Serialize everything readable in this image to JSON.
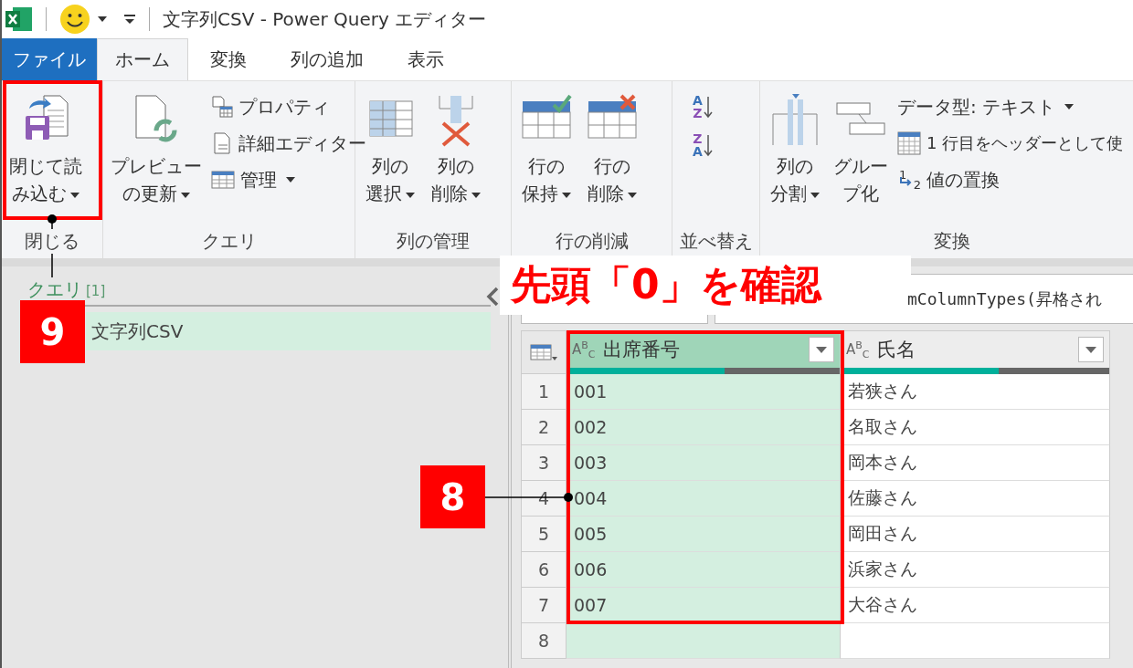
{
  "window": {
    "title": "文字列CSV - Power Query エディター"
  },
  "tabs": [
    {
      "label": "ファイル",
      "kind": "file",
      "selected": false
    },
    {
      "label": "ホーム",
      "kind": "tab",
      "selected": true
    },
    {
      "label": "変換",
      "kind": "tab",
      "selected": false
    },
    {
      "label": "列の追加",
      "kind": "tab",
      "selected": false
    },
    {
      "label": "表示",
      "kind": "tab",
      "selected": false
    }
  ],
  "ribbon": {
    "groups": [
      {
        "label": "閉じる",
        "items": [
          {
            "kind": "large",
            "lines": [
              "閉じて読",
              "み込む"
            ],
            "dropdown": true
          }
        ]
      },
      {
        "label": "クエリ",
        "items": [
          {
            "kind": "large",
            "lines": [
              "プレビュー",
              "の更新"
            ],
            "dropdown": true
          },
          {
            "kind": "stack",
            "items": [
              {
                "label": "プロパティ",
                "dropdown": false
              },
              {
                "label": "詳細エディター",
                "dropdown": false
              },
              {
                "label": "管理",
                "dropdown": true
              }
            ]
          }
        ]
      },
      {
        "label": "列の管理",
        "items": [
          {
            "kind": "large",
            "lines": [
              "列の",
              "選択"
            ],
            "dropdown": true
          },
          {
            "kind": "large",
            "lines": [
              "列の",
              "削除"
            ],
            "dropdown": true
          }
        ]
      },
      {
        "label": "行の削減",
        "items": [
          {
            "kind": "large",
            "lines": [
              "行の",
              "保持"
            ],
            "dropdown": true
          },
          {
            "kind": "large",
            "lines": [
              "行の",
              "削除"
            ],
            "dropdown": true
          }
        ]
      },
      {
        "label": "並べ替え",
        "items": [
          {
            "kind": "sort",
            "orders": [
              {
                "top": "A",
                "bottom": "Z"
              },
              {
                "top": "Z",
                "bottom": "A"
              }
            ]
          }
        ]
      },
      {
        "label": "変換",
        "items": [
          {
            "kind": "large",
            "lines": [
              "列の",
              "分割"
            ],
            "dropdown": true
          },
          {
            "kind": "large",
            "lines": [
              "グルー",
              "プ化"
            ],
            "dropdown": false
          },
          {
            "kind": "stack",
            "items": [
              {
                "label": "データ型: テキスト",
                "dropdown": true
              },
              {
                "label": "1 行目をヘッダーとして使",
                "dropdown": false
              },
              {
                "label": "値の置換",
                "dropdown": false,
                "glyphs": [
                  "1",
                  "2"
                ]
              }
            ]
          }
        ]
      }
    ]
  },
  "queries": {
    "title": "クエリ",
    "count": "[1]",
    "items": [
      {
        "label": "文字列CSV",
        "selected": true
      }
    ]
  },
  "formula_bar": {
    "text": "mColumnTypes(昇格され"
  },
  "table": {
    "columns": [
      {
        "type": "A$^{B}$$_{C}$",
        "name": "出席番号",
        "selected": true,
        "level": 0.58
      },
      {
        "type": "A$^{B}$$_{C}$",
        "name": "氏名",
        "selected": false,
        "level": 0.59
      }
    ],
    "rows": [
      {
        "num": "1",
        "cells": [
          "001",
          "若狭さん"
        ]
      },
      {
        "num": "2",
        "cells": [
          "002",
          "名取さん"
        ]
      },
      {
        "num": "3",
        "cells": [
          "003",
          "岡本さん"
        ]
      },
      {
        "num": "4",
        "cells": [
          "004",
          "佐藤さん"
        ]
      },
      {
        "num": "5",
        "cells": [
          "005",
          "岡田さん"
        ]
      },
      {
        "num": "6",
        "cells": [
          "006",
          "浜家さん"
        ]
      },
      {
        "num": "7",
        "cells": [
          "007",
          "大谷さん"
        ]
      },
      {
        "num": "8"
      }
    ]
  },
  "annotations": [
    {
      "kind": "callout",
      "text": "先頭「0」を確認"
    },
    {
      "kind": "badge",
      "text": "9"
    },
    {
      "kind": "badge",
      "text": "8"
    }
  ]
}
